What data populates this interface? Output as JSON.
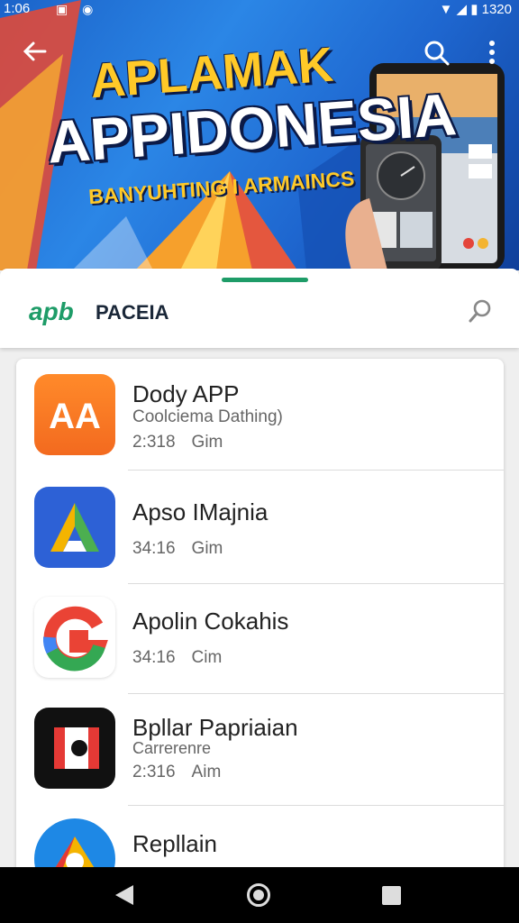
{
  "status_bar": {
    "time": "1:06",
    "battery": "1320"
  },
  "hero": {
    "line1": "APLAMAK",
    "line2": "APPIDONESIA",
    "line3": "BANYUHTING I ARMAINCS"
  },
  "sheet": {
    "brand_logo": "apb",
    "brand_name": "PACEIA"
  },
  "apps": [
    {
      "title": "Dody APP",
      "subtitle": "Coolciema Dathing)",
      "meta_a": "2:318",
      "meta_b": "Gim"
    },
    {
      "title": "Apso IMajnia",
      "subtitle": "",
      "meta_a": "34:16",
      "meta_b": "Gim"
    },
    {
      "title": "Apolin Cokahis",
      "subtitle": "",
      "meta_a": "34:16",
      "meta_b": "Cim"
    },
    {
      "title": "Bpllar Papriaian",
      "subtitle": "Carrerenre",
      "meta_a": "2:316",
      "meta_b": "Aim"
    },
    {
      "title": "Repllain",
      "subtitle": "",
      "meta_a": "",
      "meta_b": ""
    }
  ],
  "colors": {
    "accent": "#1e9c68",
    "banner_blue": "#1e66cf",
    "hero_yellow": "#ffc928"
  }
}
